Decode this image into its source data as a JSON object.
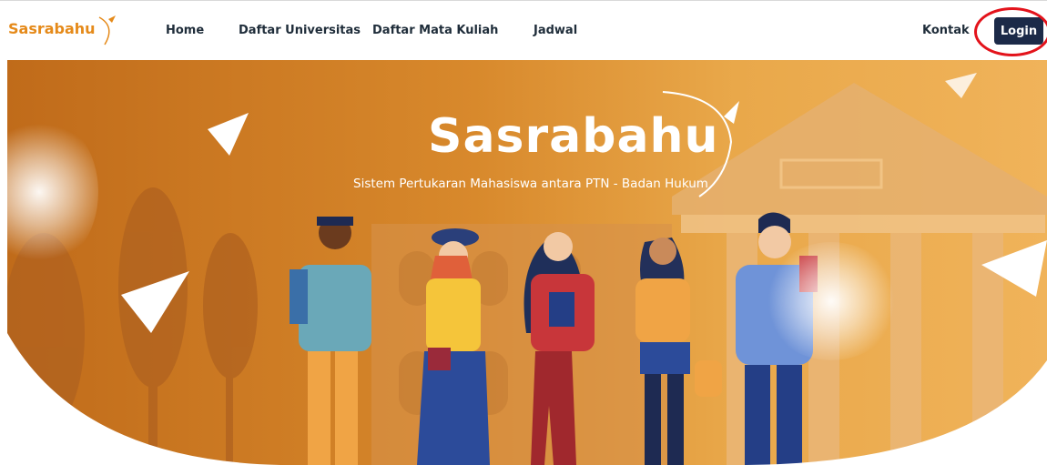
{
  "navbar": {
    "brand": "Sasrabahu",
    "links": [
      {
        "label": "Home"
      },
      {
        "label": "Daftar Universitas"
      },
      {
        "label": "Daftar Mata Kuliah"
      },
      {
        "label": "Jadwal"
      }
    ],
    "contact": "Kontak",
    "login": "Login"
  },
  "hero": {
    "title": "Sasrabahu",
    "subtitle": "Sistem Pertukaran Mahasiswa antara PTN - Badan Hukum"
  },
  "colors": {
    "brand": "#e58a1a",
    "nav_text": "#1f2d3a",
    "login_bg": "#1c2a48",
    "highlight_circle": "#e3131b",
    "hero_orange": "#d8892c"
  }
}
